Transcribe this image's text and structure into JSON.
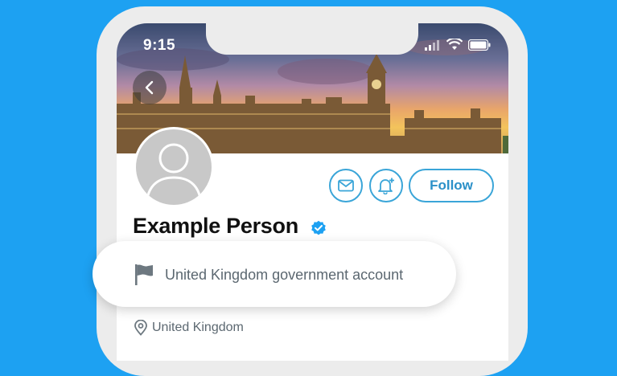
{
  "status_bar": {
    "time": "9:15"
  },
  "profile": {
    "name": "Example Person",
    "follow_label": "Follow",
    "account_label": "United Kingdom government account",
    "location": "United Kingdom"
  },
  "icons": {
    "back": "chevron-left-icon",
    "message": "envelope-icon",
    "notify": "bell-plus-icon",
    "verified": "verified-badge-icon",
    "label": "flag-icon",
    "location": "location-pin-icon"
  },
  "colors": {
    "background": "#1da1f2",
    "accent": "#3aa5d8",
    "verified": "#1da1f2"
  }
}
